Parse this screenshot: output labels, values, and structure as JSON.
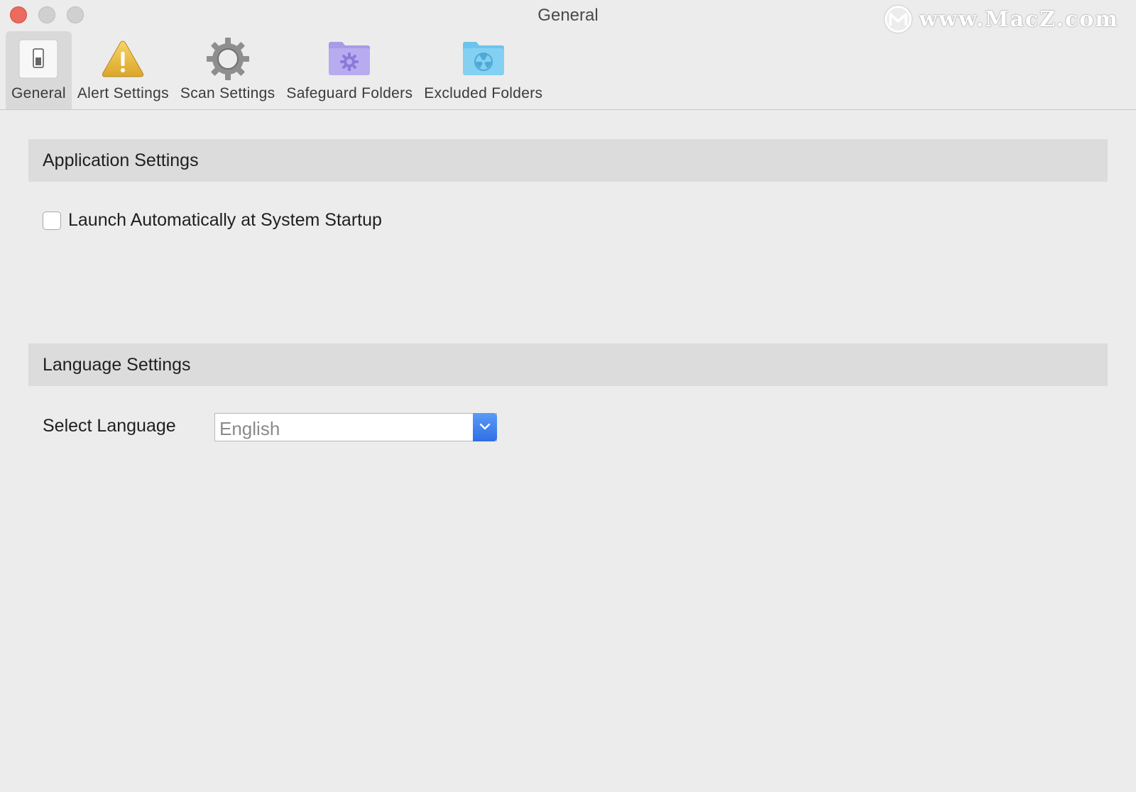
{
  "window": {
    "title": "General",
    "watermark": "www.MacZ.com"
  },
  "toolbar": {
    "items": [
      {
        "label": "General",
        "icon": "switch-icon",
        "selected": true
      },
      {
        "label": "Alert Settings",
        "icon": "warning-icon",
        "selected": false
      },
      {
        "label": "Scan Settings",
        "icon": "gear-icon",
        "selected": false
      },
      {
        "label": "Safeguard Folders",
        "icon": "purple-gear-folder-icon",
        "selected": false
      },
      {
        "label": "Excluded Folders",
        "icon": "blue-radiation-folder-icon",
        "selected": false
      }
    ]
  },
  "application_settings": {
    "title": "Application Settings",
    "launch_checkbox": {
      "label": "Launch Automatically at System Startup",
      "checked": false
    }
  },
  "language_settings": {
    "title": "Language Settings",
    "select_label": "Select Language",
    "selected_language": "English"
  },
  "colors": {
    "window_bg": "#ececec",
    "section_header_bg": "#dcdcdc",
    "close_button": "#ed6a5e",
    "select_arrow": "#2f6fe6"
  }
}
